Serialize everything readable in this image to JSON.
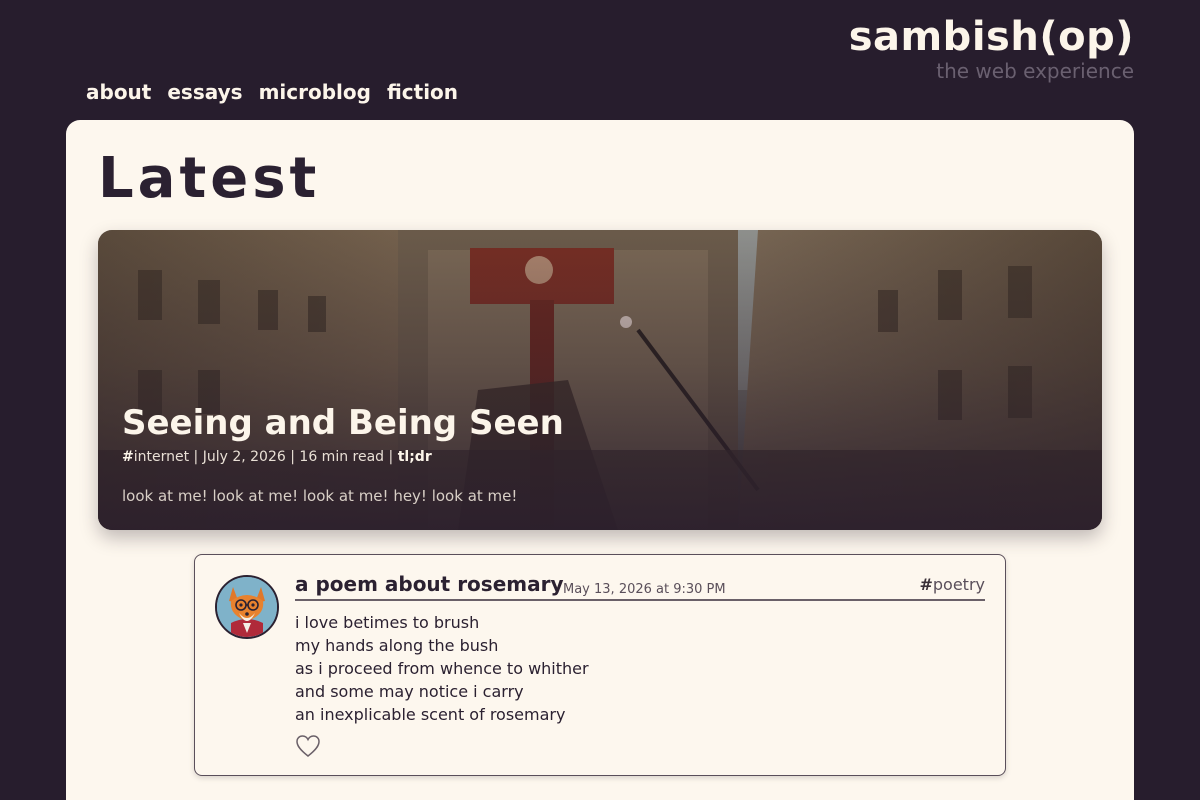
{
  "site": {
    "title": "sambish(op)",
    "tagline": "the web experience"
  },
  "nav": {
    "items": [
      "about",
      "essays",
      "microblog",
      "fiction"
    ]
  },
  "main": {
    "heading": "Latest"
  },
  "featured": {
    "title": "Seeing and Being Seen",
    "tag_hash": "#",
    "tag": "internet",
    "date": "July 2, 2026",
    "read_time": "16 min read",
    "tldr": "tl;dr",
    "separator": "|",
    "excerpt": "look at me! look at me! look at me! hey! look at me!"
  },
  "post": {
    "title": "a poem about rosemary",
    "date": "May 13, 2026 at 9:30 PM",
    "tag_hash": "#",
    "tag": "poetry",
    "lines": [
      "i love betimes to brush",
      "my hands along the bush",
      "as i proceed from whence to whither",
      "and some may notice i carry",
      "an inexplicable scent of rosemary"
    ],
    "like_icon": "heart-outline-icon",
    "avatar_icon": "fox-avatar"
  },
  "colors": {
    "background": "#271d2d",
    "card": "#fdf7ee",
    "text_dark": "#2b2131",
    "text_light": "#fcf5ea"
  }
}
